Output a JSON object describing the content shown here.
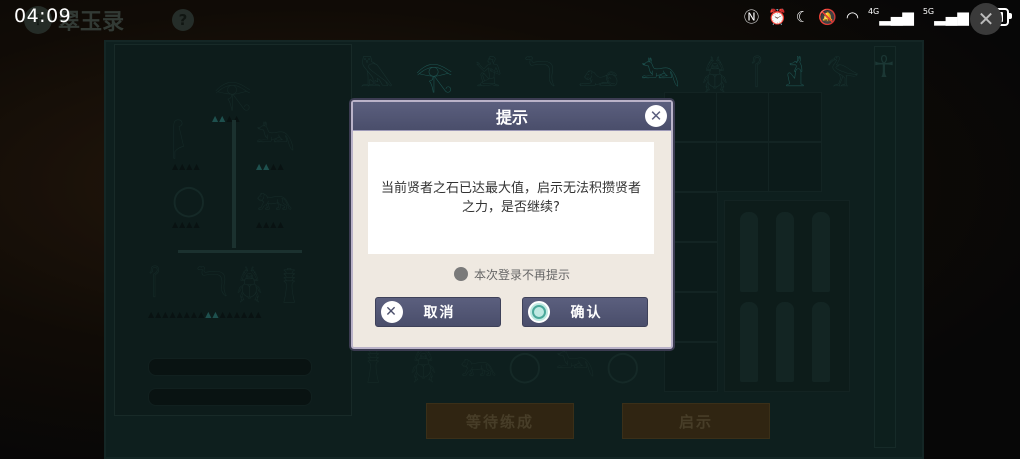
{
  "status_bar": {
    "time": "04:09",
    "net1": "4G",
    "net2": "5G"
  },
  "game": {
    "title": "翠玉录",
    "left_button": "等待练成",
    "right_button": "启示"
  },
  "dialog": {
    "title": "提示",
    "message": "当前贤者之石已达最大值，启示无法积攒贤者之力，是否继续?",
    "no_remind_label": "本次登录不再提示",
    "cancel_label": "取消",
    "confirm_label": "确认"
  },
  "colors": {
    "dialog_header": "#4a4e6b",
    "dialog_bg": "#efe9e1",
    "board_bg": "#16302e",
    "accent_teal": "#2d7f7b"
  },
  "icons": [
    "nfc-icon",
    "alarm-icon",
    "moon-icon",
    "mute-icon",
    "wifi-icon",
    "signal-icon",
    "battery-icon",
    "close-icon",
    "help-icon",
    "ankh-icon"
  ]
}
